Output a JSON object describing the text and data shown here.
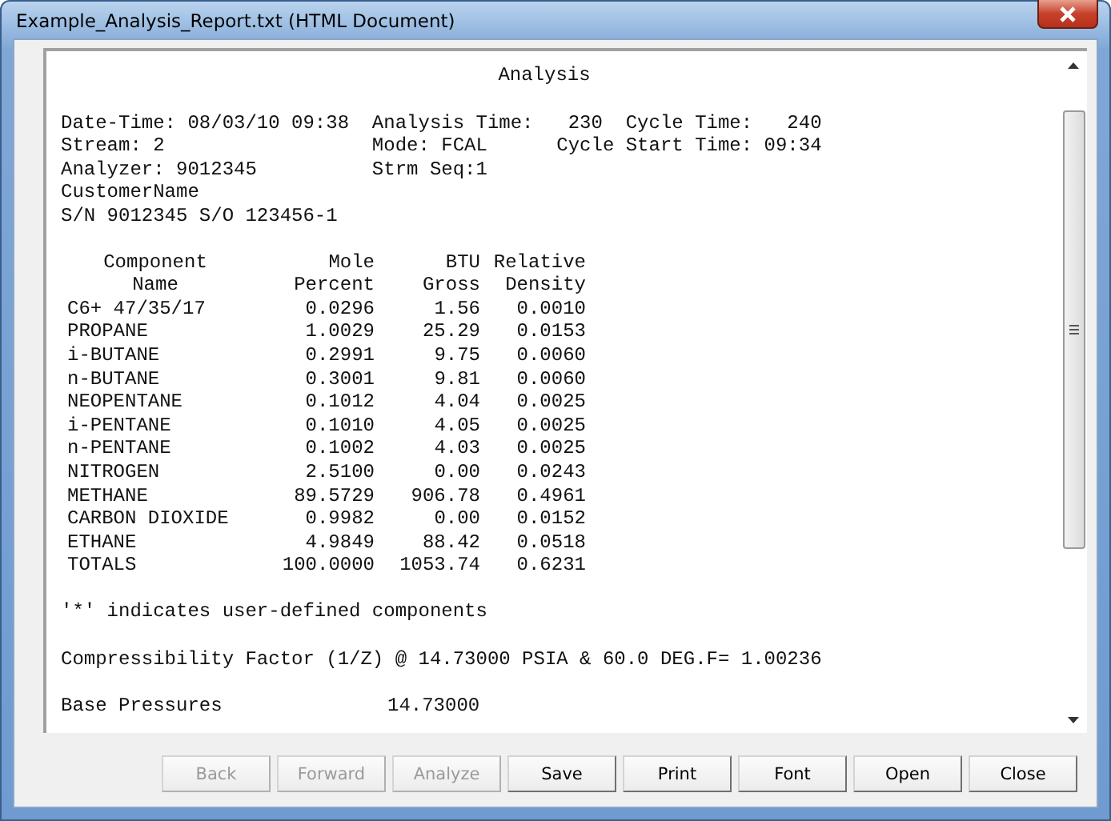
{
  "window": {
    "title": "Example_Analysis_Report.txt (HTML Document)"
  },
  "report": {
    "heading": "Analysis",
    "header_lines": [
      "Date-Time: 08/03/10 09:38  Analysis Time:   230  Cycle Time:   240",
      "Stream: 2                  Mode: FCAL      Cycle Start Time: 09:34",
      "Analyzer: 9012345          Strm Seq:1",
      "CustomerName",
      "S/N 9012345 S/O 123456-1"
    ],
    "table": {
      "header_rows": [
        [
          "Component",
          "Mole",
          "BTU",
          "Relative"
        ],
        [
          "Name",
          "Percent",
          "Gross",
          "Density"
        ]
      ],
      "rows": [
        [
          "C6+ 47/35/17",
          "0.0296",
          "1.56",
          "0.0010"
        ],
        [
          "PROPANE",
          "1.0029",
          "25.29",
          "0.0153"
        ],
        [
          "i-BUTANE",
          "0.2991",
          "9.75",
          "0.0060"
        ],
        [
          "n-BUTANE",
          "0.3001",
          "9.81",
          "0.0060"
        ],
        [
          "NEOPENTANE",
          "0.1012",
          "4.04",
          "0.0025"
        ],
        [
          "i-PENTANE",
          "0.1010",
          "4.05",
          "0.0025"
        ],
        [
          "n-PENTANE",
          "0.1002",
          "4.03",
          "0.0025"
        ],
        [
          "NITROGEN",
          "2.5100",
          "0.00",
          "0.0243"
        ],
        [
          "METHANE",
          "89.5729",
          "906.78",
          "0.4961"
        ],
        [
          "CARBON DIOXIDE",
          "0.9982",
          "0.00",
          "0.0152"
        ],
        [
          "ETHANE",
          "4.9849",
          "88.42",
          "0.0518"
        ],
        [
          "TOTALS",
          "100.0000",
          "1053.74",
          "0.6231"
        ]
      ]
    },
    "note": "'*' indicates user-defined components",
    "compressibility": "Compressibility Factor (1/Z) @ 14.73000 PSIA & 60.0 DEG.F= 1.00236",
    "base_pressures": {
      "label": "Base Pressures",
      "value": "14.73000"
    }
  },
  "buttons": [
    {
      "label": "Back",
      "disabled": true
    },
    {
      "label": "Forward",
      "disabled": true
    },
    {
      "label": "Analyze",
      "disabled": true
    },
    {
      "label": "Save",
      "disabled": false
    },
    {
      "label": "Print",
      "disabled": false
    },
    {
      "label": "Font",
      "disabled": false
    },
    {
      "label": "Open",
      "disabled": false
    },
    {
      "label": "Close",
      "disabled": false
    }
  ]
}
